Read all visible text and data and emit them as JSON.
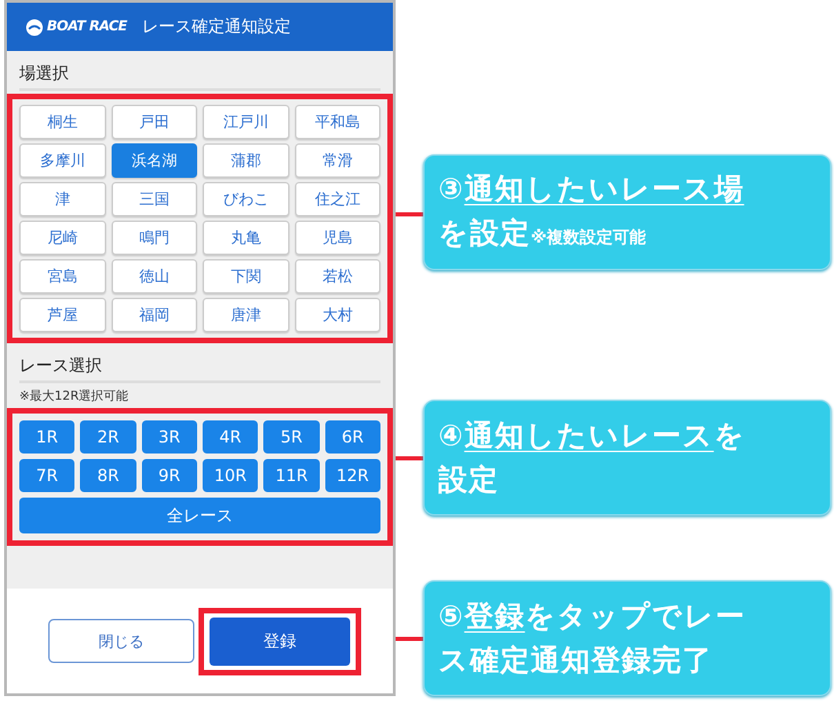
{
  "header": {
    "logo": "BOAT RACE",
    "title": "レース確定通知設定"
  },
  "venue_section": {
    "label": "場選択",
    "venues": [
      {
        "name": "桐生",
        "selected": false
      },
      {
        "name": "戸田",
        "selected": false
      },
      {
        "name": "江戸川",
        "selected": false
      },
      {
        "name": "平和島",
        "selected": false
      },
      {
        "name": "多摩川",
        "selected": false
      },
      {
        "name": "浜名湖",
        "selected": true
      },
      {
        "name": "蒲郡",
        "selected": false
      },
      {
        "name": "常滑",
        "selected": false
      },
      {
        "name": "津",
        "selected": false
      },
      {
        "name": "三国",
        "selected": false
      },
      {
        "name": "びわこ",
        "selected": false
      },
      {
        "name": "住之江",
        "selected": false
      },
      {
        "name": "尼崎",
        "selected": false
      },
      {
        "name": "鳴門",
        "selected": false
      },
      {
        "name": "丸亀",
        "selected": false
      },
      {
        "name": "児島",
        "selected": false
      },
      {
        "name": "宮島",
        "selected": false
      },
      {
        "name": "徳山",
        "selected": false
      },
      {
        "name": "下関",
        "selected": false
      },
      {
        "name": "若松",
        "selected": false
      },
      {
        "name": "芦屋",
        "selected": false
      },
      {
        "name": "福岡",
        "selected": false
      },
      {
        "name": "唐津",
        "selected": false
      },
      {
        "name": "大村",
        "selected": false
      }
    ]
  },
  "race_section": {
    "label": "レース選択",
    "note": "※最大12R選択可能",
    "races": [
      {
        "label": "1R",
        "selected": true
      },
      {
        "label": "2R",
        "selected": true
      },
      {
        "label": "3R",
        "selected": true
      },
      {
        "label": "4R",
        "selected": true
      },
      {
        "label": "5R",
        "selected": true
      },
      {
        "label": "6R",
        "selected": true
      },
      {
        "label": "7R",
        "selected": true
      },
      {
        "label": "8R",
        "selected": true
      },
      {
        "label": "9R",
        "selected": true
      },
      {
        "label": "10R",
        "selected": true
      },
      {
        "label": "11R",
        "selected": true
      },
      {
        "label": "12R",
        "selected": true
      }
    ],
    "all_races": {
      "label": "全レース",
      "selected": true
    }
  },
  "footer": {
    "close_button": "閉じる",
    "register_button": "登録"
  },
  "callouts": [
    {
      "lines": [
        [
          {
            "kind": "plain",
            "text": "③"
          },
          {
            "kind": "underline",
            "text": "通知したいレース場"
          }
        ],
        [
          {
            "kind": "plain",
            "text": "を設定"
          },
          {
            "kind": "note",
            "text": "※複数設定可能"
          }
        ]
      ]
    },
    {
      "lines": [
        [
          {
            "kind": "plain",
            "text": "④"
          },
          {
            "kind": "underline",
            "text": "通知したいレース"
          },
          {
            "kind": "plain",
            "text": "を"
          }
        ],
        [
          {
            "kind": "plain",
            "text": "設定"
          }
        ]
      ]
    },
    {
      "lines": [
        [
          {
            "kind": "plain",
            "text": "⑤"
          },
          {
            "kind": "underline",
            "text": "登録"
          },
          {
            "kind": "plain",
            "text": "をタップでレー"
          }
        ],
        [
          {
            "kind": "plain",
            "text": "ス確定通知登録完了"
          }
        ]
      ]
    }
  ]
}
